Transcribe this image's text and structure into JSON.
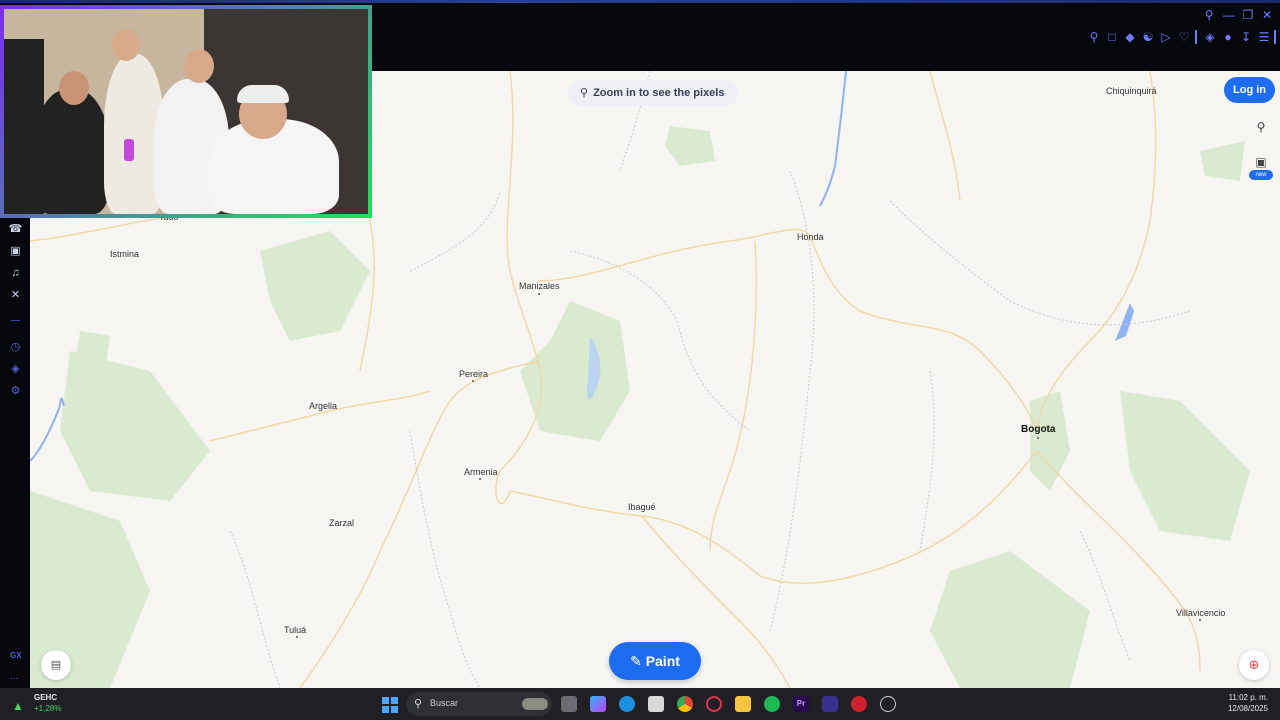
{
  "map": {
    "zoom_hint": "Zoom in to see the pixels",
    "login_label": "Log in",
    "new_badge": "new",
    "paint_label": "Paint",
    "cities": [
      {
        "name": "Chiquinquirá",
        "bold": false
      },
      {
        "name": "Tadó",
        "bold": false
      },
      {
        "name": "Istmina",
        "bold": false
      },
      {
        "name": "Honda",
        "bold": false
      },
      {
        "name": "Manizales",
        "bold": false
      },
      {
        "name": "Pereira",
        "bold": false
      },
      {
        "name": "Argelia",
        "bold": false
      },
      {
        "name": "Bogota",
        "bold": true
      },
      {
        "name": "Armenia",
        "bold": false
      },
      {
        "name": "Ibagué",
        "bold": false
      },
      {
        "name": "Zarzal",
        "bold": false
      },
      {
        "name": "Villavicencio",
        "bold": false
      },
      {
        "name": "Tuluá",
        "bold": false
      }
    ],
    "colors": {
      "water": "#8fb2f0",
      "roads": "#f1d9a6",
      "parks": "#d9ead0",
      "accent": "#1e6cf0"
    }
  },
  "sidebar": {
    "icons": [
      "whatsapp-icon",
      "instagram-icon",
      "tiktok-icon",
      "x-icon",
      "history-icon",
      "extensions-icon",
      "settings-icon"
    ],
    "gx_label": "GX",
    "more_label": "..."
  },
  "taskbar": {
    "stock_name": "GEHC",
    "stock_change": "+1,28%",
    "search_label": "Buscar",
    "time": "11:02 p. m.",
    "date": "12/08/2025"
  }
}
